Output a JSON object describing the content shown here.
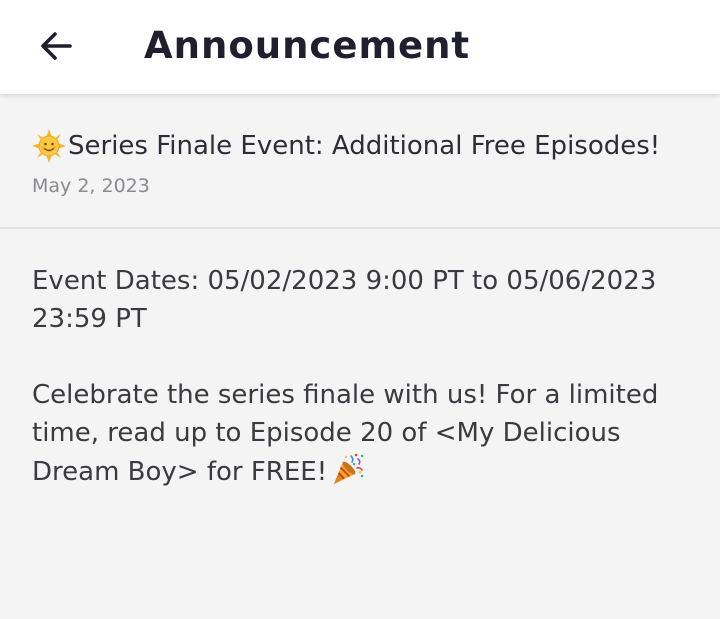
{
  "header": {
    "title": "Announcement",
    "back_icon": "back-arrow-icon"
  },
  "announcement": {
    "title_emoji": "sun-with-face-icon",
    "title": "Series Finale Event: Additional Free Episodes!",
    "date": "May 2, 2023",
    "body": {
      "event_dates": "Event Dates: 05/02/2023 9:00 PT to 05/06/2023 23:59 PT",
      "celebrate": "Celebrate the series finale with us! For a limited time, read up to Episode 20 of <My Delicious Dream Boy> for FREE!",
      "end_emoji": "party-popper-icon"
    }
  },
  "colors": {
    "header_bg": "#ffffff",
    "page_bg": "#f4f4f5",
    "title_text": "#1f1f2e",
    "body_text": "#3a3a3f",
    "date_text": "#8a8a8f",
    "divider": "#e2e2e4"
  }
}
